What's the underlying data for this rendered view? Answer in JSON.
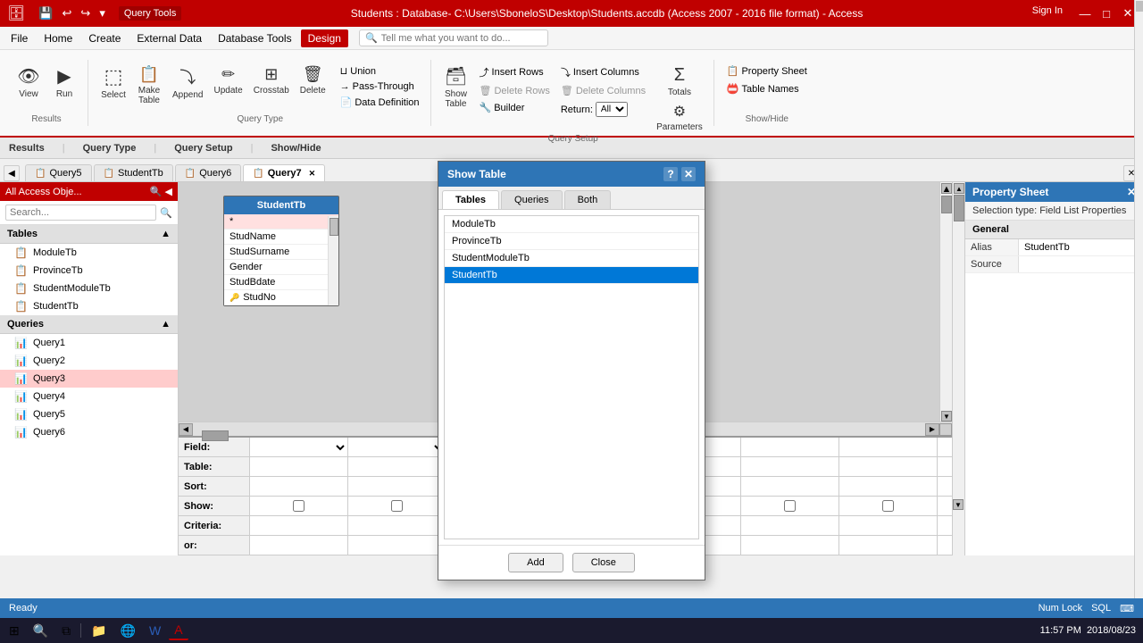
{
  "app": {
    "title": "Students : Database- C:\\Users\\SboneloS\\Desktop\\Students.accdb (Access 2007 - 2016 file format) - Access",
    "query_tools_label": "Query Tools",
    "sign_in": "Sign In"
  },
  "title_bar": {
    "quick_access_save": "💾",
    "quick_access_undo": "↩",
    "quick_access_redo": "↪",
    "quick_access_more": "▾",
    "min": "—",
    "max": "□",
    "close": "✕"
  },
  "menu": {
    "items": [
      "File",
      "Home",
      "Create",
      "External Data",
      "Database Tools",
      "Design"
    ]
  },
  "ribbon": {
    "tell_me": "Tell me what you want to do...",
    "groups": {
      "results": {
        "label": "Results",
        "view_label": "View",
        "run_label": "Run"
      },
      "query_type": {
        "label": "Query Type",
        "select_label": "Select",
        "make_table_label": "Make\nTable",
        "append_label": "Append",
        "update_label": "Update",
        "crosstab_label": "Crosstab",
        "delete_label": "Delete",
        "union_label": "Union",
        "pass_through_label": "Pass-Through",
        "data_definition_label": "Data Definition"
      },
      "query_setup": {
        "label": "Query Setup",
        "show_table_label": "Show\nTable",
        "insert_rows_label": "Insert Rows",
        "insert_columns_label": "Insert Columns",
        "delete_rows_label": "Delete Rows",
        "delete_columns_label": "Delete Columns",
        "return_label": "Return:",
        "return_value": "All",
        "builder_label": "Builder",
        "totals_label": "Totals",
        "parameters_label": "Parameters"
      },
      "show_hide": {
        "label": "Show/Hide",
        "property_sheet_label": "Property Sheet",
        "table_names_label": "Table Names"
      }
    }
  },
  "section_labels": [
    "Results",
    "Query Type",
    "Query Setup",
    "Show/Hide"
  ],
  "query_tabs": [
    {
      "label": "Query5",
      "icon": "📋"
    },
    {
      "label": "StudentTb",
      "icon": "📋"
    },
    {
      "label": "Query6",
      "icon": "📋"
    },
    {
      "label": "Query7",
      "icon": "📋",
      "active": true
    }
  ],
  "sidebar": {
    "title": "All Access Obje...",
    "search_placeholder": "Search...",
    "sections": {
      "tables": {
        "label": "Tables",
        "items": [
          "ModuleTb",
          "ProvinceTb",
          "StudentModuleTb",
          "StudentTb"
        ]
      },
      "queries": {
        "label": "Queries",
        "items": [
          "Query1",
          "Query2",
          "Query3",
          "Query4",
          "Query5",
          "Query6"
        ],
        "active": "Query3"
      }
    }
  },
  "student_table_box": {
    "title": "StudentTb",
    "fields": [
      "*",
      "StudName",
      "StudSurname",
      "Gender",
      "StudBdate",
      "StudNo"
    ]
  },
  "show_table_dialog": {
    "title": "Show Table",
    "tabs": [
      "Tables",
      "Queries",
      "Both"
    ],
    "active_tab": "Tables",
    "tables": [
      "ModuleTb",
      "ProvinceTb",
      "StudentModuleTb",
      "StudentTb"
    ],
    "selected": "StudentTb",
    "add_label": "Add",
    "close_label": "Close"
  },
  "property_sheet": {
    "title": "Property Sheet",
    "close_label": "✕",
    "selection_type_label": "Selection type: Field List Properties",
    "section": "General",
    "rows": [
      {
        "key": "Alias",
        "value": "StudentTb"
      },
      {
        "key": "Source",
        "value": ""
      }
    ]
  },
  "field_grid": {
    "row_labels": [
      "Field:",
      "Table:",
      "Sort:",
      "Show:",
      "Criteria:",
      "or:"
    ],
    "columns": 8
  },
  "status_bar": {
    "ready": "Ready",
    "num_lock": "Num Lock",
    "sql": "SQL"
  },
  "taskbar": {
    "time": "11:57 PM",
    "date": "2018/08/23"
  }
}
